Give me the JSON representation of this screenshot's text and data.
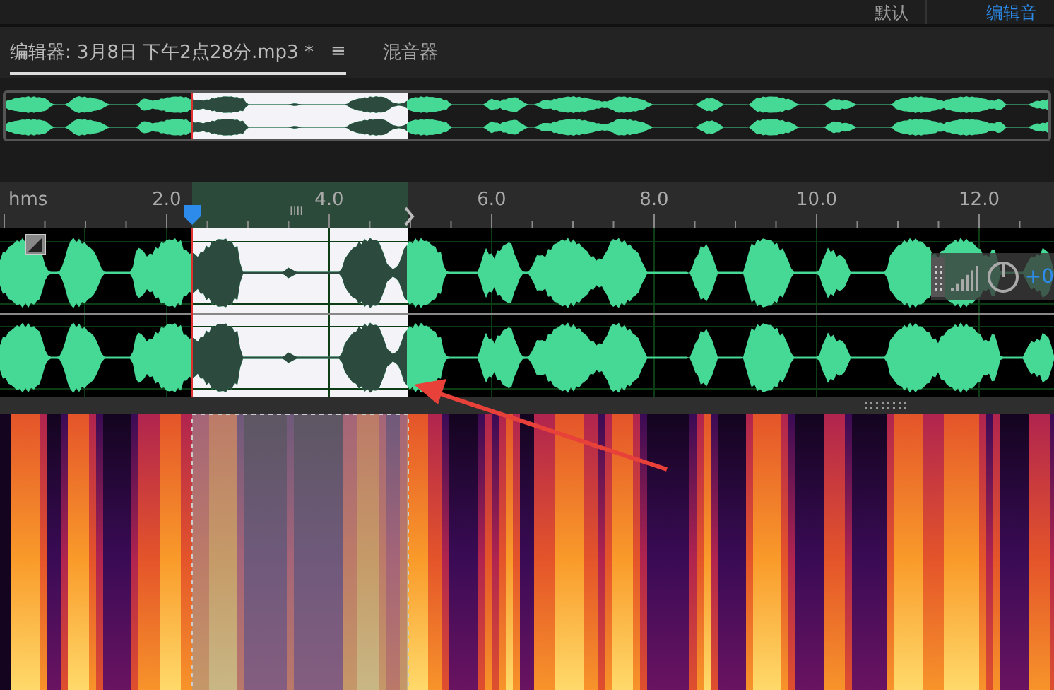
{
  "workspaces": [
    {
      "label": "默认",
      "selected": false
    },
    {
      "label": "编辑音",
      "selected": true
    }
  ],
  "tabs": [
    {
      "label": "编辑器: 3月8日 下午2点28分.mp3 *",
      "selected": true,
      "menu": "≡"
    },
    {
      "label": "混音器",
      "selected": false
    }
  ],
  "ruler": {
    "unit": "hms",
    "ticks": [
      "2.0",
      "4.0",
      "6.0",
      "8.0",
      "10.0",
      "12.0"
    ],
    "selection_marker": "IIII"
  },
  "amplitude": {
    "reading": "+0"
  }
}
